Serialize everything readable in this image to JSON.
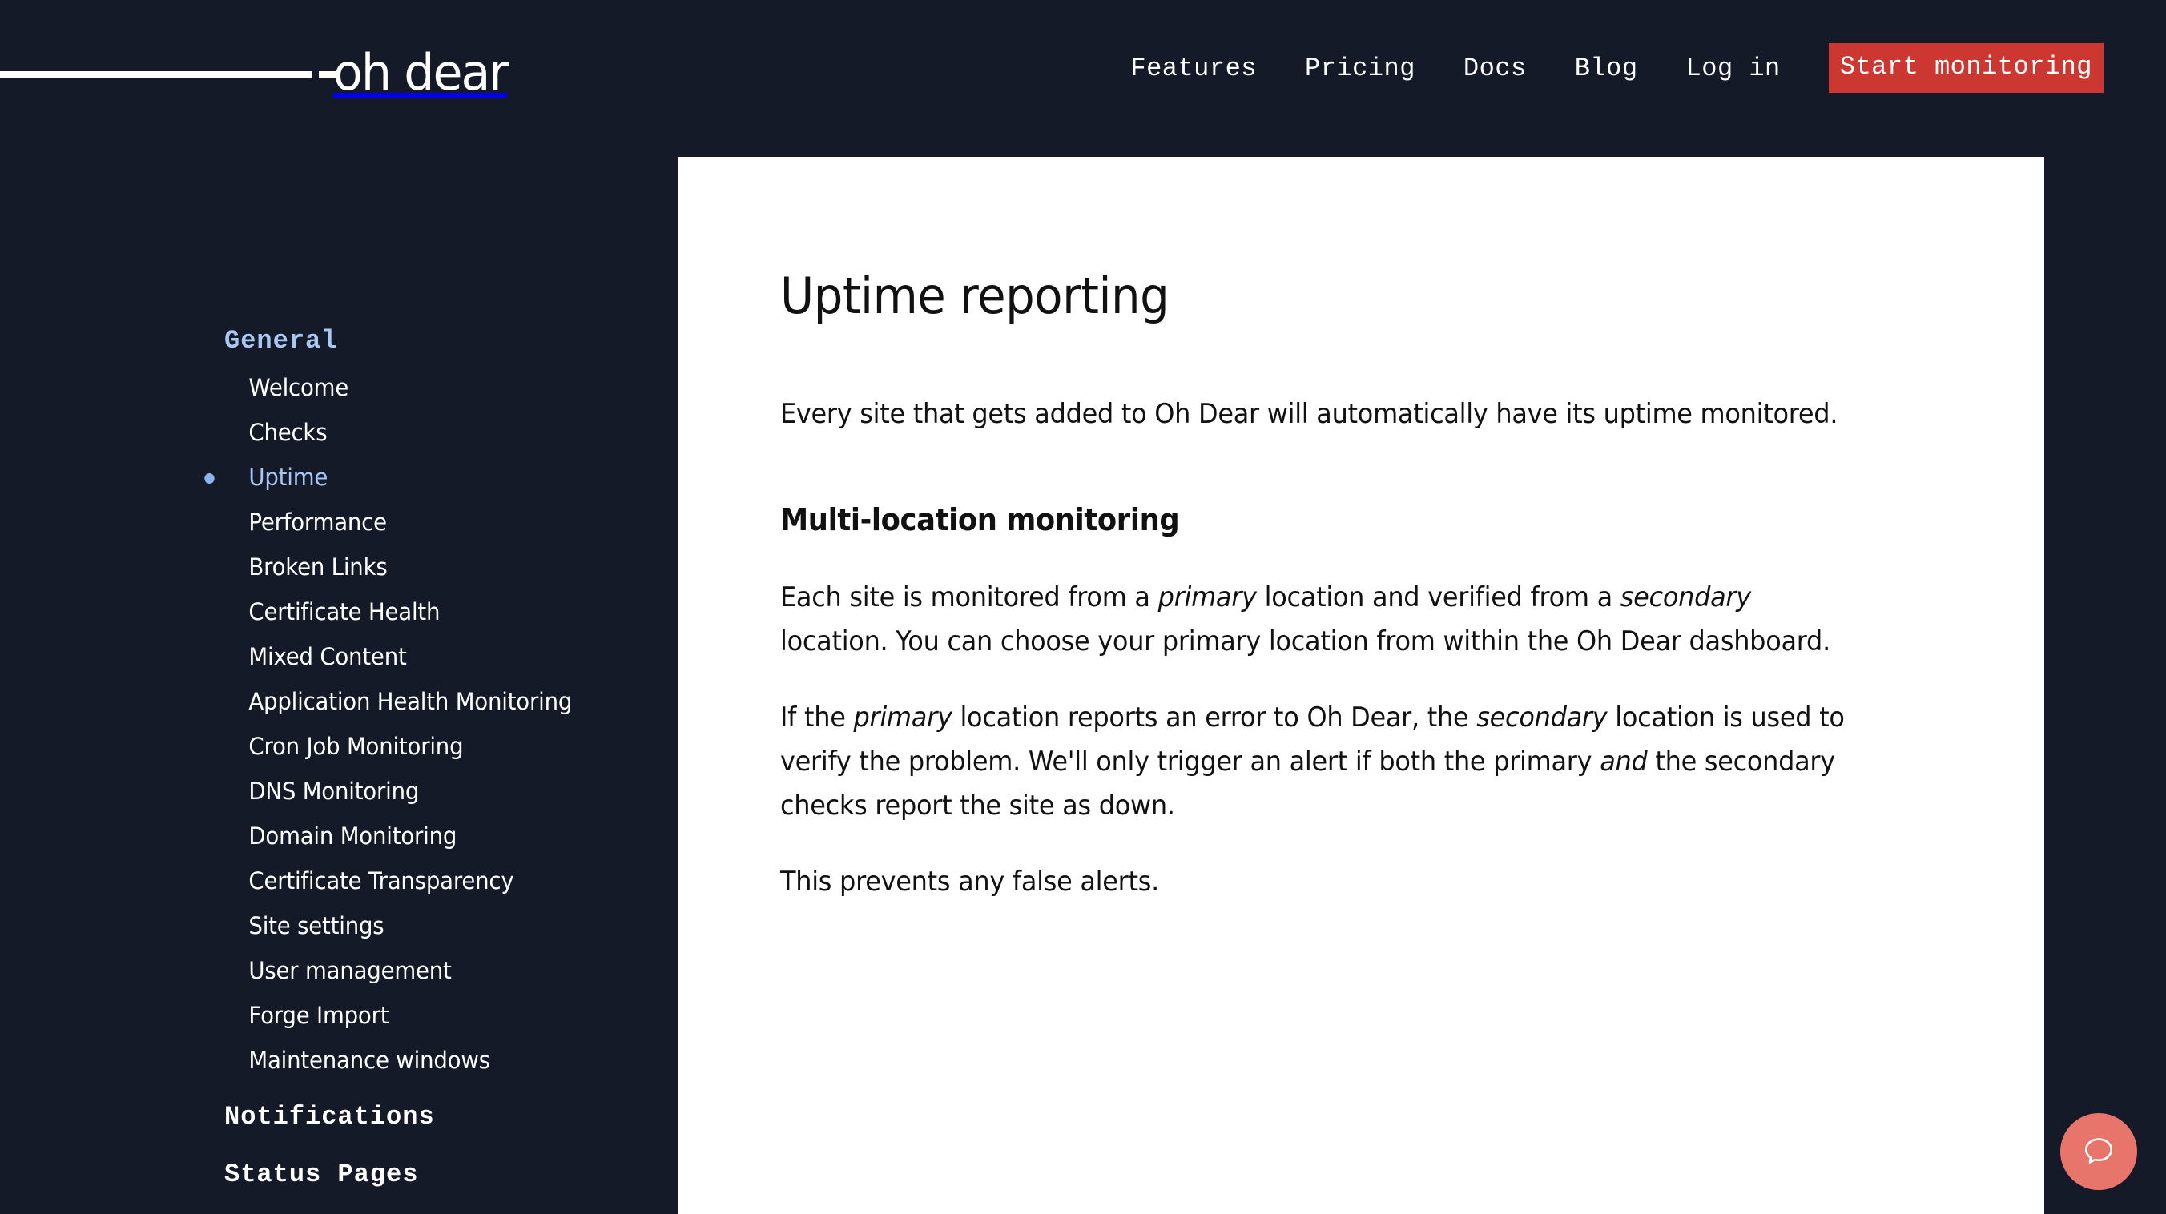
{
  "brand": {
    "logo_text": "oh dear",
    "logo_mark": "horizontal-rule-dash"
  },
  "topnav": {
    "links": [
      {
        "label": "Features"
      },
      {
        "label": "Pricing"
      },
      {
        "label": "Docs"
      },
      {
        "label": "Blog"
      },
      {
        "label": "Log in"
      }
    ],
    "cta": {
      "label": "Start monitoring",
      "bg": "#cd3731",
      "color": "#ffffff"
    }
  },
  "sidebar": {
    "groups": [
      {
        "title": "General",
        "items": [
          {
            "label": "Welcome",
            "active": false
          },
          {
            "label": "Checks",
            "active": false
          },
          {
            "label": "Uptime",
            "active": true
          },
          {
            "label": "Performance",
            "active": false
          },
          {
            "label": "Broken Links",
            "active": false
          },
          {
            "label": "Certificate Health",
            "active": false
          },
          {
            "label": "Mixed Content",
            "active": false
          },
          {
            "label": "Application Health Monitoring",
            "active": false
          },
          {
            "label": "Cron Job Monitoring",
            "active": false
          },
          {
            "label": "DNS Monitoring",
            "active": false
          },
          {
            "label": "Domain Monitoring",
            "active": false
          },
          {
            "label": "Certificate Transparency",
            "active": false
          },
          {
            "label": "Site settings",
            "active": false
          },
          {
            "label": "User management",
            "active": false
          },
          {
            "label": "Forge Import",
            "active": false
          },
          {
            "label": "Maintenance windows",
            "active": false
          }
        ]
      },
      {
        "title": "Notifications",
        "items": []
      },
      {
        "title": "Status Pages",
        "items": []
      }
    ],
    "active_color": "#a9c7f4",
    "heading_color": "#a9c7f4"
  },
  "main": {
    "title": "Uptime reporting",
    "intro": "Every site that gets added to Oh Dear will automatically have its uptime monitored.",
    "section_heading": "Multi-location monitoring",
    "para_1": {
      "part_1": "Each site is monitored from a ",
      "em_1": "primary",
      "part_2": " location and verified from a ",
      "em_2": "secondary",
      "part_3": " location. You can choose your primary location from within the Oh Dear dashboard."
    },
    "para_2": {
      "part_1": "If the ",
      "em_1": "primary",
      "part_2": " location reports an error to Oh Dear, the ",
      "em_2": "secondary",
      "part_3": " location is used to verify the problem. We'll only trigger an alert if both the primary ",
      "em_3": "and",
      "part_4": " the secondary checks report the site as down."
    },
    "para_3": "This prevents any false alerts."
  },
  "chat": {
    "icon": "chat-bubble-icon",
    "bg": "#e8756b"
  },
  "theme": {
    "page_bg": "#141a28",
    "panel_bg": "#ffffff",
    "text_light": "#ffffff",
    "accent_red": "#cd3731",
    "accent_blue": "#a9c7f4"
  }
}
